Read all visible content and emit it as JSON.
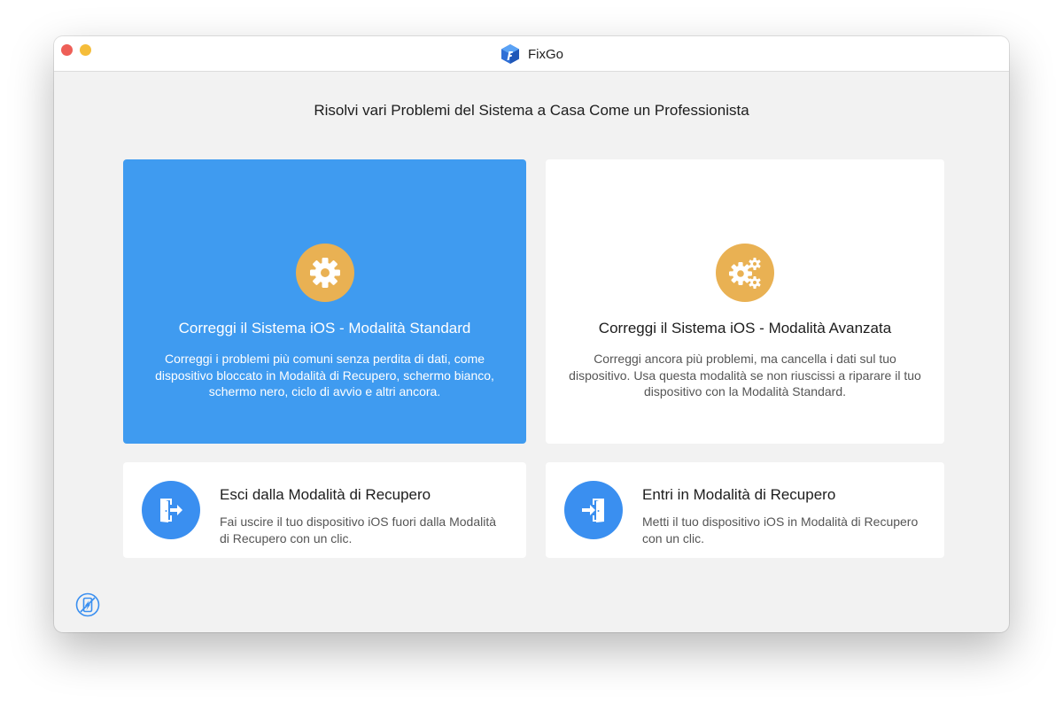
{
  "window": {
    "title": "FixGo",
    "controls": [
      "close",
      "minimize"
    ]
  },
  "heading": "Risolvi vari Problemi del Sistema a Casa Come un Professionista",
  "cards": {
    "standard": {
      "title": "Correggi il Sistema iOS - Modalità Standard",
      "description": "Correggi i problemi più comuni senza perdita di dati, come dispositivo bloccato in Modalità di Recupero, schermo bianco, schermo nero, ciclo di avvio e altri ancora.",
      "icon": "gear-icon",
      "selected": true
    },
    "advanced": {
      "title": "Correggi il Sistema iOS - Modalità Avanzata",
      "description": "Correggi ancora più problemi, ma cancella i dati sul tuo dispositivo. Usa questa modalità se non riuscissi a riparare il tuo dispositivo con la Modalità Standard.",
      "icon": "gears-icon",
      "selected": false
    },
    "exit_recovery": {
      "title": "Esci dalla Modalità di Recupero",
      "description": "Fai uscire il tuo dispositivo iOS fuori dalla Modalità di Recupero con un clic.",
      "icon": "exit-door-icon"
    },
    "enter_recovery": {
      "title": "Entri in Modalità di Recupero",
      "description": "Metti il tuo dispositivo iOS in Modalità di Recupero con un clic.",
      "icon": "enter-door-icon"
    }
  },
  "footer_icon": "device-repair-icon",
  "colors": {
    "accent_blue": "#3f9bf0",
    "icon_blue": "#3a8ff0",
    "gear_orange": "#e9b153",
    "window_bg": "#f2f2f2",
    "card_bg": "#ffffff"
  }
}
